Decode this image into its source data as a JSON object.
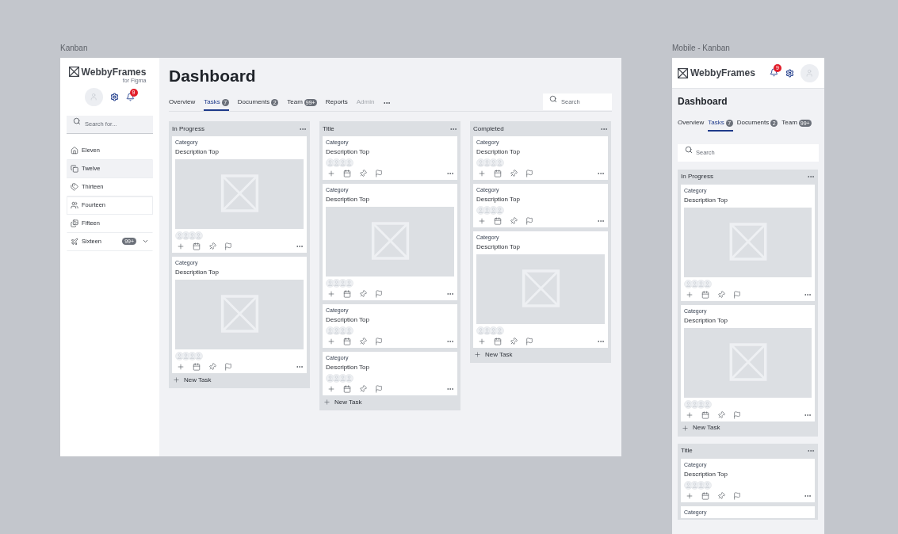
{
  "desktop": {
    "frame_label": "Kanban",
    "logo": "WebbyFrames",
    "logo_sub": "for Figma",
    "notification_count": "9",
    "sidebar_search": {
      "placeholder": "Search for..."
    },
    "nav": [
      {
        "label": "Eleven",
        "selected": false,
        "hovered": false
      },
      {
        "label": "Twelve",
        "selected": true,
        "hovered": false
      },
      {
        "label": "Thirteen",
        "selected": false,
        "hovered": false
      },
      {
        "label": "Fourteen",
        "selected": false,
        "hovered": true
      },
      {
        "label": "Fifteen",
        "selected": false,
        "hovered": false
      },
      {
        "label": "Sixteen",
        "selected": false,
        "hovered": false,
        "badge": "99+",
        "expanded": false
      }
    ],
    "title": "Dashboard",
    "tabs": [
      {
        "label": "Overview",
        "selected": false,
        "disabled": false
      },
      {
        "label": "Tasks",
        "count": "7",
        "selected": true,
        "disabled": false
      },
      {
        "label": "Documents",
        "count": "2",
        "selected": false,
        "disabled": false
      },
      {
        "label": "Team",
        "count": "99+",
        "selected": false,
        "disabled": false
      },
      {
        "label": "Reports",
        "selected": false,
        "disabled": false
      },
      {
        "label": "Admin",
        "selected": false,
        "disabled": true
      }
    ],
    "search": {
      "placeholder": "Search"
    },
    "columns": [
      {
        "title": "In Progress",
        "new_task": "New Task",
        "cards": [
          {
            "kind": "image",
            "category": "Category",
            "description": "Description Top"
          },
          {
            "kind": "image",
            "category": "Category",
            "description": "Description Top"
          }
        ]
      },
      {
        "title": "Title",
        "new_task": "New Task",
        "cards": [
          {
            "kind": "plain",
            "category": "Category",
            "description": "Description Top"
          },
          {
            "kind": "image",
            "category": "Category",
            "description": "Description Top"
          },
          {
            "kind": "plain",
            "category": "Category",
            "description": "Description Top"
          },
          {
            "kind": "plain",
            "category": "Category",
            "description": "Description Top"
          }
        ]
      },
      {
        "title": "Completed",
        "new_task": "New Task",
        "cards": [
          {
            "kind": "plain",
            "category": "Category",
            "description": "Description Top"
          },
          {
            "kind": "plain",
            "category": "Category",
            "description": "Description Top"
          },
          {
            "kind": "image",
            "category": "Category",
            "description": "Description Top"
          }
        ]
      }
    ]
  },
  "mobile": {
    "frame_label": "Mobile - Kanban",
    "logo": "WebbyFrames",
    "notification_count": "9",
    "title": "Dashboard",
    "tabs": [
      {
        "label": "Overview",
        "selected": false
      },
      {
        "label": "Tasks",
        "count": "7",
        "selected": true
      },
      {
        "label": "Documents",
        "count": "2",
        "selected": false
      },
      {
        "label": "Team",
        "count": "99+",
        "selected": false
      }
    ],
    "search": {
      "placeholder": "Search"
    },
    "columns": [
      {
        "title": "In Progress",
        "new_task": "New Task",
        "cards": [
          {
            "kind": "image",
            "category": "Category",
            "description": "Description Top"
          },
          {
            "kind": "image",
            "category": "Category",
            "description": "Description Top"
          }
        ]
      },
      {
        "title": "Title",
        "cards": [
          {
            "kind": "plain",
            "category": "Category",
            "description": "Description Top"
          },
          {
            "kind": "plain",
            "category": "Category"
          }
        ]
      }
    ]
  }
}
